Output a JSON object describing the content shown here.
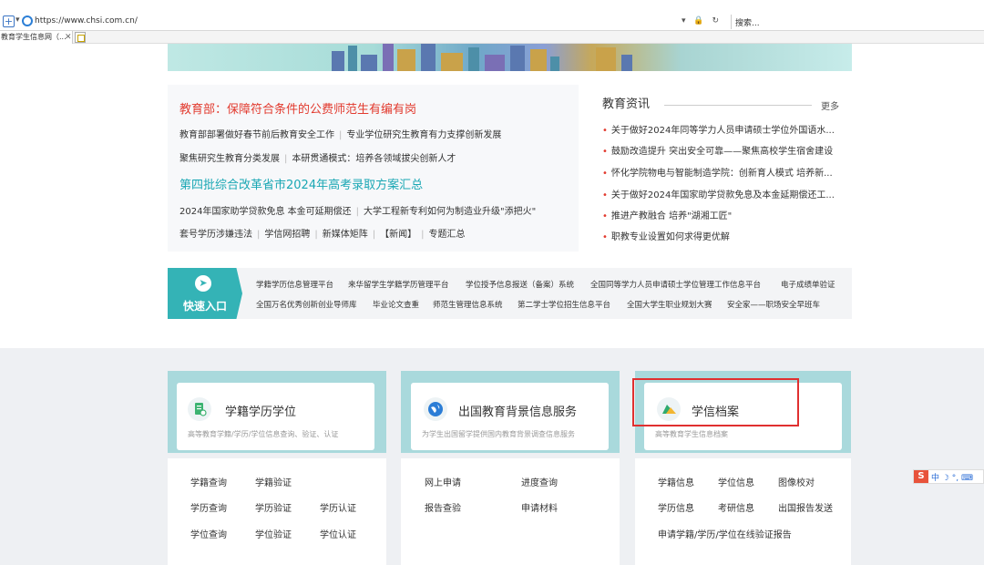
{
  "browser": {
    "url": "https://www.chsi.com.cn/",
    "search_placeholder": "搜索...",
    "tab_title": "教育学生信息网（..."
  },
  "news_left": {
    "headline1": "教育部：保障符合条件的公费师范生有编有岗",
    "row1": [
      "教育部部署做好春节前后教育安全工作",
      "专业学位研究生教育有力支撑创新发展"
    ],
    "row2": [
      "聚焦研究生教育分类发展",
      "本研贯通模式：培养各领域拔尖创新人才"
    ],
    "headline2": "第四批综合改革省市2024年高考录取方案汇总",
    "row3": [
      "2024年国家助学贷款免息 本金可延期偿还",
      "大学工程新专利如何为制造业升级\"添把火\""
    ],
    "row4": [
      "套号学历涉嫌违法",
      "学信网招聘",
      "新媒体矩阵",
      "【新闻】",
      "专题汇总"
    ]
  },
  "news_right": {
    "title": "教育资讯",
    "more": "更多",
    "items": [
      "关于做好2024年同等学力人员申请硕士学位外国语水...",
      "鼓励改造提升 突出安全可靠——聚焦高校学生宿舍建设",
      "怀化学院物电与智能制造学院：创新育人模式 培养新...",
      "关于做好2024年国家助学贷款免息及本金延期偿还工...",
      "推进产教融合 培养\"湖湘工匠\"",
      "职教专业设置如何求得更优解"
    ]
  },
  "quick": {
    "label": "快速入口",
    "row1": [
      "学籍学历信息管理平台",
      "来华留学生学籍学历管理平台",
      "学位授予信息报送（备案）系统",
      "全国同等学力人员申请硕士学位管理工作信息平台",
      "电子成绩单验证"
    ],
    "row2": [
      "全国万名优秀创新创业导师库",
      "毕业论文查重",
      "师范生管理信息系统",
      "第二学士学位招生信息平台",
      "全国大学生职业规划大赛",
      "安全家——职场安全早班车"
    ]
  },
  "services": [
    {
      "title": "学籍学历学位",
      "subtitle": "高等教育学籍/学历/学位信息查询、验证、认证",
      "links": [
        [
          "学籍查询",
          "学籍验证"
        ],
        [
          "学历查询",
          "学历验证",
          "学历认证"
        ],
        [
          "学位查询",
          "学位验证",
          "学位认证"
        ]
      ]
    },
    {
      "title": "出国教育背景信息服务",
      "subtitle": "为学生出国留学提供国内教育背景调查信息服务",
      "links": [
        [
          "网上申请",
          "进度查询"
        ],
        [
          "报告查验",
          "申请材料"
        ]
      ]
    },
    {
      "title": "学信档案",
      "subtitle": "高等教育学生信息档案",
      "links": [
        [
          "学籍信息",
          "学位信息",
          "图像校对"
        ],
        [
          "学历信息",
          "考研信息",
          "出国报告发送"
        ],
        [
          "申请学籍/学历/学位在线验证报告"
        ]
      ]
    }
  ],
  "ime": {
    "text": "中 ☽ °, ⌨"
  },
  "colors": {
    "accent_teal": "#34b3b6",
    "headline_red": "#e23a2e",
    "headline_teal": "#1aa7b4",
    "highlight_box": "#e03030"
  }
}
